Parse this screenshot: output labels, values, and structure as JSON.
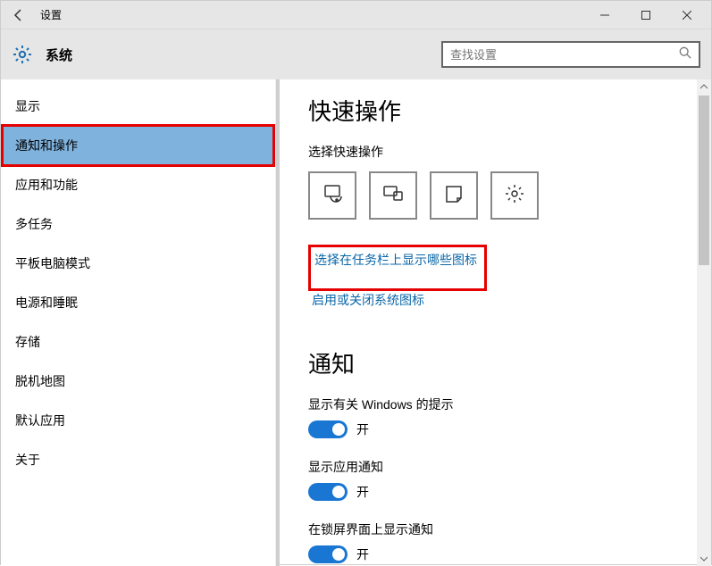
{
  "titlebar": {
    "title": "设置"
  },
  "header": {
    "page_title": "系统"
  },
  "search": {
    "placeholder": "查找设置"
  },
  "sidebar": {
    "items": [
      {
        "label": "显示"
      },
      {
        "label": "通知和操作"
      },
      {
        "label": "应用和功能"
      },
      {
        "label": "多任务"
      },
      {
        "label": "平板电脑模式"
      },
      {
        "label": "电源和睡眠"
      },
      {
        "label": "存储"
      },
      {
        "label": "脱机地图"
      },
      {
        "label": "默认应用"
      },
      {
        "label": "关于"
      }
    ],
    "selected_index": 1
  },
  "content": {
    "quick_actions": {
      "heading": "快速操作",
      "subheading": "选择快速操作"
    },
    "links": {
      "taskbar_icons": "选择在任务栏上显示哪些图标",
      "system_icons": "启用或关闭系统图标"
    },
    "notifications": {
      "heading": "通知",
      "items": [
        {
          "label": "显示有关 Windows 的提示",
          "on": true,
          "state": "开"
        },
        {
          "label": "显示应用通知",
          "on": true,
          "state": "开"
        },
        {
          "label": "在锁屏界面上显示通知",
          "on": true,
          "state": "开"
        }
      ]
    }
  },
  "annotations": {
    "highlight_sidebar_index": 1,
    "highlight_link": "taskbar_icons"
  }
}
